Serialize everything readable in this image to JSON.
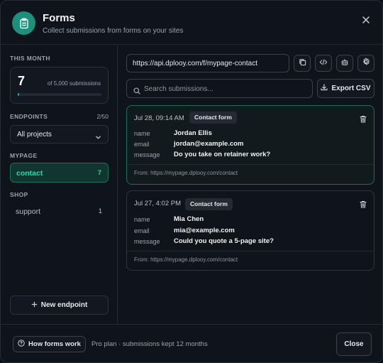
{
  "header": {
    "title": "Forms",
    "subtitle": "Collect submissions from forms on your sites",
    "icon": "clipboard-icon",
    "accent": "#1e8f7d"
  },
  "sidebar": {
    "month_label": "THIS MONTH",
    "usage": {
      "count": "7",
      "of_label": "of 5,000 submissions",
      "fraction": 0.0014
    },
    "endpoints_label": "ENDPOINTS",
    "endpoints_count": "2/50",
    "project_select": "All projects",
    "groups": [
      {
        "label": "MYPAGE",
        "items": [
          {
            "name": "contact",
            "count": "7",
            "active": true
          }
        ]
      },
      {
        "label": "SHOP",
        "items": [
          {
            "name": "support",
            "count": "1",
            "active": false
          }
        ]
      }
    ],
    "new_endpoint_label": "New endpoint"
  },
  "main": {
    "endpoint_url": "https://api.dplooy.com/f/mypage-contact",
    "action_icons": [
      "copy-icon",
      "code-icon",
      "robot-icon",
      "settings-icon"
    ],
    "search_placeholder": "Search submissions...",
    "export_label": "Export CSV",
    "submissions": [
      {
        "date": "Jul 28, 09:14 AM",
        "badge": "Contact form",
        "fields": [
          {
            "key": "name",
            "value": "Jordan Ellis"
          },
          {
            "key": "email",
            "value": "jordan@example.com"
          },
          {
            "key": "message",
            "value": "Do you take on retainer work?"
          }
        ],
        "from": "From: https://mypage.dplooy.com/contact",
        "highlight": true
      },
      {
        "date": "Jul 27, 4:02 PM",
        "badge": "Contact form",
        "fields": [
          {
            "key": "name",
            "value": "Mia Chen"
          },
          {
            "key": "email",
            "value": "mia@example.com"
          },
          {
            "key": "message",
            "value": "Could you quote a 5-page site?"
          }
        ],
        "from": "From: https://mypage.dplooy.com/contact",
        "highlight": false
      }
    ]
  },
  "footer": {
    "help_label": "How forms work",
    "plan_text": "Pro plan · submissions kept 12 months",
    "close_label": "Close"
  }
}
